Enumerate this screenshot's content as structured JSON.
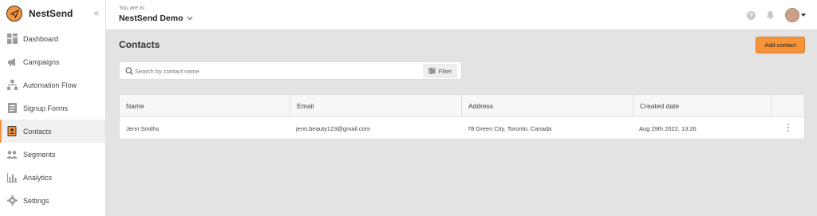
{
  "brand": {
    "name": "NestSend",
    "collapse_label": "«"
  },
  "nav": [
    {
      "label": "Dashboard",
      "icon": "dashboard-icon"
    },
    {
      "label": "Campaigns",
      "icon": "megaphone-icon"
    },
    {
      "label": "Automation Flow",
      "icon": "flow-icon"
    },
    {
      "label": "Signup Forms",
      "icon": "form-icon"
    },
    {
      "label": "Contacts",
      "icon": "contacts-icon",
      "active": true
    },
    {
      "label": "Segments",
      "icon": "users-icon"
    },
    {
      "label": "Analytics",
      "icon": "bar-chart-icon"
    },
    {
      "label": "Settings",
      "icon": "gear-icon"
    }
  ],
  "topbar": {
    "you_are_in": "You are in:",
    "workspace": "NestSend Demo",
    "help": "?"
  },
  "page": {
    "title": "Contacts",
    "add_button": "Add contact"
  },
  "search": {
    "placeholder": "Search by contact name",
    "value": "",
    "filter_label": "Filter"
  },
  "table": {
    "columns": [
      "Name",
      "Email",
      "Address",
      "Created date"
    ],
    "rows": [
      [
        "Jenn Smiths",
        "jenn.beauty123@gmail.com",
        "78 Green City, Toronto, Canada",
        "Aug 29th 2022, 13:26"
      ]
    ]
  },
  "colors": {
    "accent": "#f7943a",
    "background": "#e3e3e3",
    "surface": "#ffffff"
  }
}
